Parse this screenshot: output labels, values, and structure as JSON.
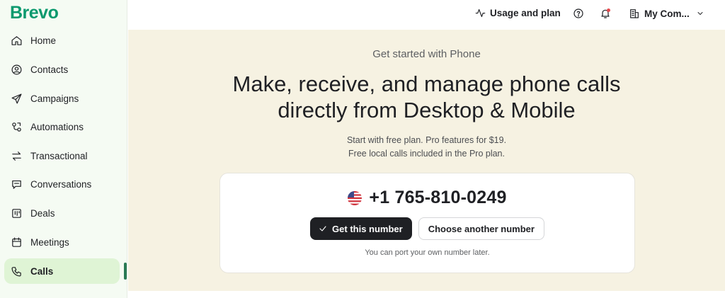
{
  "brand": {
    "logo_text": "Brevo",
    "accent": "#0b996e"
  },
  "sidebar": {
    "items": [
      {
        "label": "Home",
        "icon": "home-icon"
      },
      {
        "label": "Contacts",
        "icon": "contacts-icon"
      },
      {
        "label": "Campaigns",
        "icon": "paper-plane-icon"
      },
      {
        "label": "Automations",
        "icon": "automation-icon"
      },
      {
        "label": "Transactional",
        "icon": "transfer-arrows-icon"
      },
      {
        "label": "Conversations",
        "icon": "chat-bubble-icon"
      },
      {
        "label": "Deals",
        "icon": "kanban-icon"
      },
      {
        "label": "Meetings",
        "icon": "calendar-icon"
      },
      {
        "label": "Calls",
        "icon": "phone-icon",
        "active": true
      }
    ],
    "active_color": "#dff4d5"
  },
  "topbar": {
    "usage_label": "Usage and plan",
    "account_label": "My Com...",
    "icons": [
      "activity-icon",
      "help-icon",
      "bell-icon",
      "building-icon",
      "chevron-down-icon"
    ]
  },
  "hero": {
    "eyebrow": "Get started with Phone",
    "headline_line1": "Make, receive, and manage phone calls",
    "headline_line2": "directly from Desktop & Mobile",
    "sub_line1": "Start with free plan. Pro features for $19.",
    "sub_line2": "Free local calls included in the Pro plan.",
    "background": "#f6f2e2"
  },
  "card": {
    "flag_icon": "us-flag-icon",
    "phone_number": "+1 765-810-0249",
    "primary_button": "Get this number",
    "secondary_button": "Choose another number",
    "note": "You can port your own number later."
  }
}
